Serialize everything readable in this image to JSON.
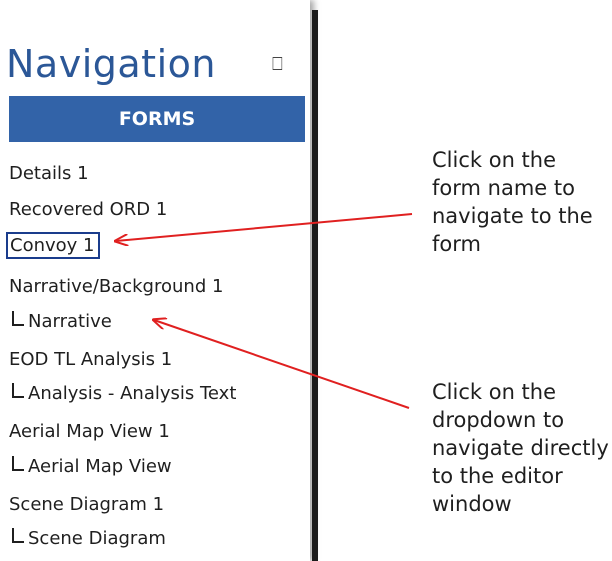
{
  "panel": {
    "title": "Navigation",
    "pin_icon": "pin-icon",
    "section_header": "FORMS"
  },
  "nav_items": [
    {
      "label": "Details 1",
      "level": 0,
      "selected": false
    },
    {
      "label": "Recovered ORD 1",
      "level": 0,
      "selected": false
    },
    {
      "label": "Convoy 1",
      "level": 0,
      "selected": true
    },
    {
      "label": "Narrative/Background 1",
      "level": 0,
      "selected": false
    },
    {
      "label": "Narrative",
      "level": 1,
      "selected": false
    },
    {
      "label": "EOD TL Analysis 1",
      "level": 0,
      "selected": false
    },
    {
      "label": "Analysis - Analysis Text",
      "level": 1,
      "selected": false
    },
    {
      "label": "Aerial Map View 1",
      "level": 0,
      "selected": false
    },
    {
      "label": "Aerial Map View",
      "level": 1,
      "selected": false
    },
    {
      "label": "Scene Diagram 1",
      "level": 0,
      "selected": false
    },
    {
      "label": "Scene Diagram",
      "level": 1,
      "selected": false
    }
  ],
  "annotations": {
    "form_name": "Click on the form name to navigate to the form",
    "dropdown": "Click on the dropdown to navigate directly to the editor window"
  },
  "colors": {
    "title": "#2b5797",
    "header_bg": "#3263a8",
    "selection_border": "#1a3c8c",
    "arrow": "#e02020"
  }
}
